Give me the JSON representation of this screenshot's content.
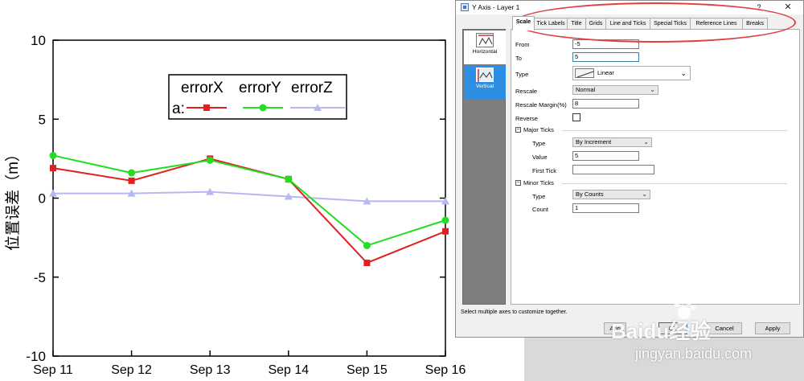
{
  "chart_data": {
    "type": "line",
    "x": [
      "Sep 11",
      "Sep 12",
      "Sep 13",
      "Sep 14",
      "Sep 15",
      "Sep 16"
    ],
    "series": [
      {
        "name": "errorX",
        "values": [
          1.9,
          1.1,
          2.5,
          1.2,
          -4.1,
          -2.1
        ],
        "color": "#e02020",
        "marker": "square"
      },
      {
        "name": "errorY",
        "values": [
          2.7,
          1.6,
          2.4,
          1.2,
          -3.0,
          -1.4
        ],
        "color": "#22dd22",
        "marker": "circle"
      },
      {
        "name": "errorZ",
        "values": [
          0.3,
          0.3,
          0.4,
          0.1,
          -0.2,
          -0.2
        ],
        "color": "#b8b8f0",
        "marker": "triangle"
      }
    ],
    "ylabel": "位置误差（m）",
    "ylim": [
      -10,
      10
    ],
    "yticks": [
      "10",
      "5",
      "0",
      "-5",
      "-10"
    ],
    "yticks_values": [
      10,
      5,
      0,
      -5,
      -10
    ],
    "legend_prefix": "a:",
    "legend_placement": "top-right",
    "grid": false
  },
  "dialog": {
    "title": "Y Axis - Layer 1",
    "help": "?",
    "close": "✕",
    "tabs": [
      "Scale",
      "Tick Labels",
      "Title",
      "Grids",
      "Line and Ticks",
      "Special Ticks",
      "Reference Lines",
      "Breaks"
    ],
    "active_tab": "Scale",
    "side_items": [
      "Horizontal",
      "Vertical"
    ],
    "selected_side": "Vertical",
    "fields": {
      "from_label": "From",
      "from_value": "-5",
      "to_label": "To",
      "to_value": "5",
      "type_label": "Type",
      "type_value": "Linear",
      "rescale_label": "Rescale",
      "rescale_value": "Normal",
      "rescale_margin_label": "Rescale Margin(%)",
      "rescale_margin_value": "8",
      "reverse_label": "Reverse",
      "reverse_checked": false
    },
    "major_ticks": {
      "header": "Major Ticks",
      "type_label": "Type",
      "type_value": "By Increment",
      "value_label": "Value",
      "value_value": "5",
      "first_tick_label": "First Tick",
      "first_tick_value": ""
    },
    "minor_ticks": {
      "header": "Minor Ticks",
      "type_label": "Type",
      "type_value": "By Counts",
      "count_label": "Count",
      "count_value": "1"
    },
    "hint": "Select multiple axes to customize together.",
    "buttons": {
      "apply_partial": "App",
      "ok": "OK",
      "cancel": "Cancel",
      "apply": "Apply"
    },
    "accent": "#2d8fe3"
  },
  "watermark": {
    "brand": "Baidu经验",
    "url": "jingyan.baidu.com"
  }
}
